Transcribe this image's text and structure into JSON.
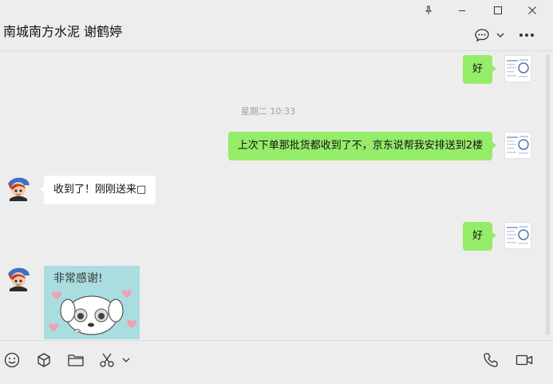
{
  "header": {
    "title": "南城南方水泥 谢鹤婷"
  },
  "messages": [
    {
      "sender": "self",
      "text": "好"
    },
    {
      "timestamp": "星期二 10:33"
    },
    {
      "sender": "self",
      "text": "上次下单那批货都收到了不，京东说帮我安排送到2楼"
    },
    {
      "sender": "other",
      "text": "收到了！刚刚送来□"
    },
    {
      "sender": "self",
      "text": "好"
    },
    {
      "sender": "other",
      "sticker_text": "非常感谢!"
    }
  ],
  "colors": {
    "self_bubble": "#95ec69",
    "other_bubble": "#ffffff",
    "background": "#ededed",
    "sticker_bg": "#a9dde0"
  },
  "icons": {
    "window": [
      "pin-icon",
      "minimize-icon",
      "maximize-icon",
      "close-icon"
    ],
    "header": [
      "chat-bubble-icon",
      "chevron-down-icon",
      "more-icon"
    ],
    "toolbar": [
      "emoji-icon",
      "package-icon",
      "folder-icon",
      "scissors-icon",
      "chevron-down-icon",
      "phone-icon",
      "video-icon"
    ]
  }
}
